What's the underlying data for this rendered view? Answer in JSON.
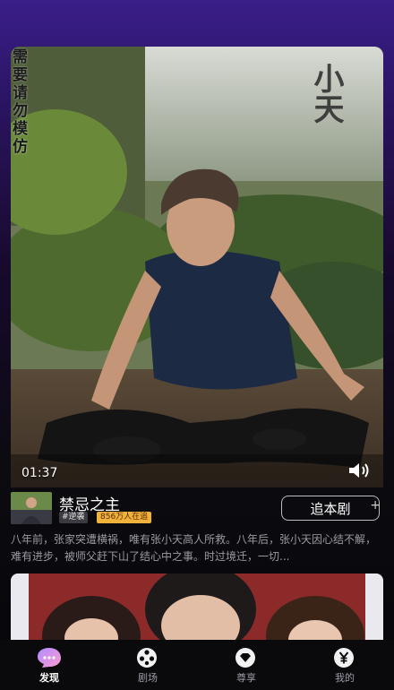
{
  "video": {
    "overlay_vertical_text": "需要\n请勿模仿",
    "calligraphy_text": "小天",
    "current_time": "01:37"
  },
  "drama": {
    "title": "禁忌之主",
    "genre_tag": "#逆袭",
    "followers_tag": "856万人在追",
    "follow_button": "追本剧",
    "follow_plus": "+",
    "synopsis": "八年前，张家突遭横祸，唯有张小天高人所救。八年后，张小天因心结不解，难有进步，被师父赶下山了结心中之事。时过境迁，一切..."
  },
  "nav": {
    "items": [
      {
        "label": "发现",
        "icon": "discover-icon",
        "active": true
      },
      {
        "label": "剧场",
        "icon": "film-reel-icon",
        "active": false
      },
      {
        "label": "尊享",
        "icon": "diamond-icon",
        "active": false
      },
      {
        "label": "我的",
        "icon": "yen-icon",
        "active": false
      }
    ]
  },
  "colors": {
    "accent_gold": "#f1b23c",
    "active_nav": "#c9a8ff"
  }
}
